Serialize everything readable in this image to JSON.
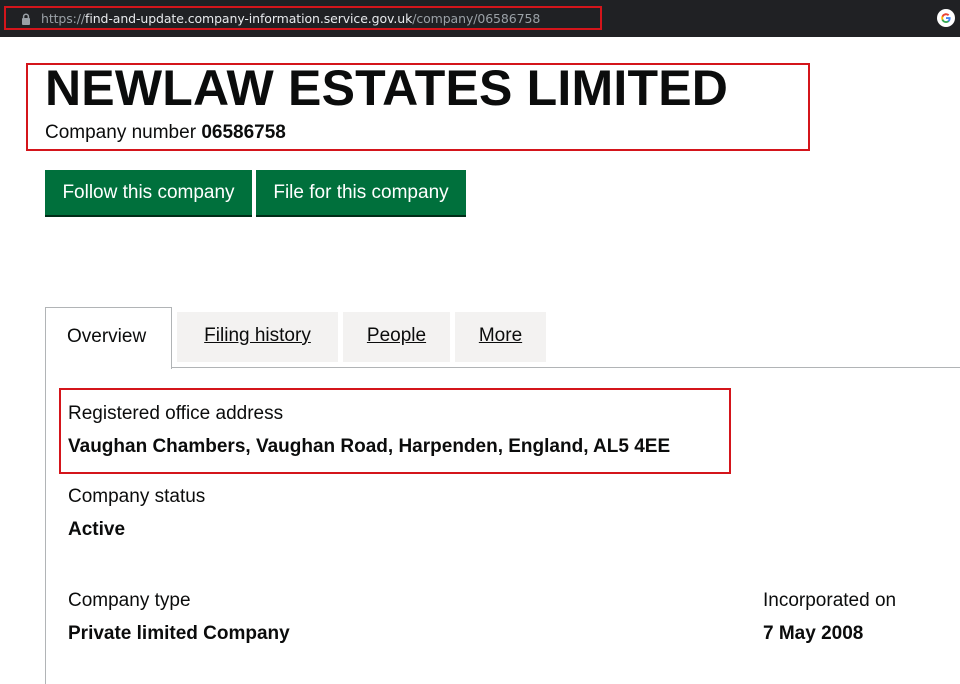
{
  "browser": {
    "url_scheme": "https://",
    "url_host": "find-and-update.company-information.service.gov.uk",
    "url_path": "/company/06586758",
    "icons": {
      "lock": "lock-icon",
      "google": "google-icon"
    }
  },
  "company": {
    "name": "NEWLAW ESTATES LIMITED",
    "number_label": "Company number",
    "number": "06586758"
  },
  "actions": {
    "follow_label": "Follow this company",
    "file_label": "File for this company"
  },
  "tabs": [
    {
      "label": "Overview",
      "active": true
    },
    {
      "label": "Filing history",
      "active": false
    },
    {
      "label": "People",
      "active": false
    },
    {
      "label": "More",
      "active": false
    }
  ],
  "overview": {
    "address_label": "Registered office address",
    "address_value": "Vaughan Chambers, Vaughan Road, Harpenden, England, AL5 4EE",
    "status_label": "Company status",
    "status_value": "Active",
    "type_label": "Company type",
    "type_value": "Private limited Company",
    "incorporated_label": "Incorporated on",
    "incorporated_value": "7 May 2008"
  },
  "colors": {
    "button_green": "#00703c",
    "highlight_red": "#d4151b",
    "browser_bar": "#202124",
    "tab_inactive_bg": "#f3f2f1"
  }
}
